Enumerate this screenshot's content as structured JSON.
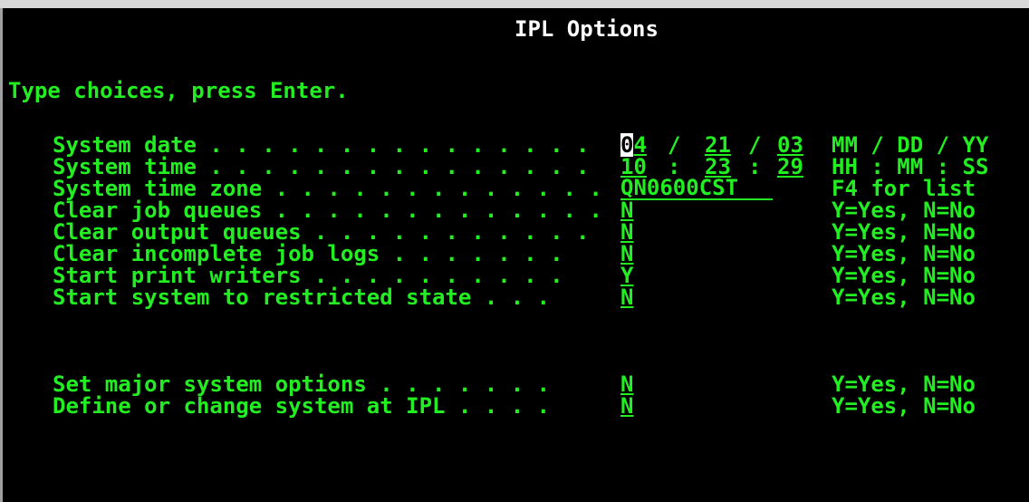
{
  "screen": {
    "title": "IPL Options",
    "instruction": "Type choices, press Enter."
  },
  "fields": {
    "system_date": {
      "label": "System date . . . . . . . . . . . . . . .",
      "month": "04",
      "day": "21",
      "year": "03",
      "separator": "/",
      "hint": "MM / DD / YY"
    },
    "system_time": {
      "label": "System time . . . . . . . . . . . . . . .",
      "hour": "10",
      "minute": "23",
      "second": "29",
      "separator": ":",
      "hint": "HH : MM : SS"
    },
    "system_time_zone": {
      "label": "System time zone . . . . . . . . . . . . .",
      "value": "QN0600CST",
      "hint": "F4 for list"
    },
    "clear_job_queues": {
      "label": "Clear job queues . . . . . . . . . . . . .",
      "value": "N",
      "hint": "Y=Yes, N=No"
    },
    "clear_output_queues": {
      "label": "Clear output queues . . . . . . . . . . .",
      "value": "N",
      "hint": "Y=Yes, N=No"
    },
    "clear_incomplete_job_logs": {
      "label": "Clear incomplete job logs . . . . . . .",
      "value": "N",
      "hint": "Y=Yes, N=No"
    },
    "start_print_writers": {
      "label": "Start print writers . . . . . . . . . .",
      "value": "Y",
      "hint": "Y=Yes, N=No"
    },
    "start_system_restricted": {
      "label": "Start system to restricted state . . .",
      "value": "N",
      "hint": "Y=Yes, N=No"
    },
    "set_major_system_options": {
      "label": "Set major system options . . . . . . .",
      "value": "N",
      "hint": "Y=Yes, N=No"
    },
    "define_or_change_system": {
      "label": "Define or change system at IPL . . . .",
      "value": "N",
      "hint": "Y=Yes, N=No"
    }
  },
  "colors": {
    "background": "#000000",
    "text_green": "#22ee22",
    "title_white": "#ffffff"
  }
}
